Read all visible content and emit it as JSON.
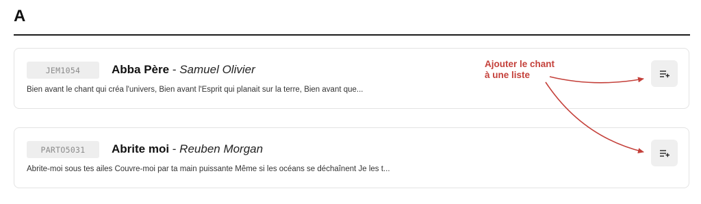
{
  "section": {
    "letter": "A"
  },
  "songs": [
    {
      "ref": "JEM1054",
      "title": "Abba Père",
      "separator": " - ",
      "author": "Samuel Olivier",
      "excerpt": "Bien avant le chant qui créa l'univers, Bien avant l'Esprit qui planait sur la terre, Bien avant que...",
      "action_icon": "playlist-add-icon"
    },
    {
      "ref": "PARTO5031",
      "title": "Abrite moi",
      "separator": " - ",
      "author": "Reuben Morgan",
      "excerpt": "Abrite-moi sous tes ailes Couvre-moi par ta main puissante Même si les océans se déchaînent Je les t...",
      "action_icon": "playlist-add-icon"
    }
  ],
  "annotation": {
    "line1": "Ajouter le chant",
    "line2": "à une liste",
    "color": "#c4403a"
  }
}
